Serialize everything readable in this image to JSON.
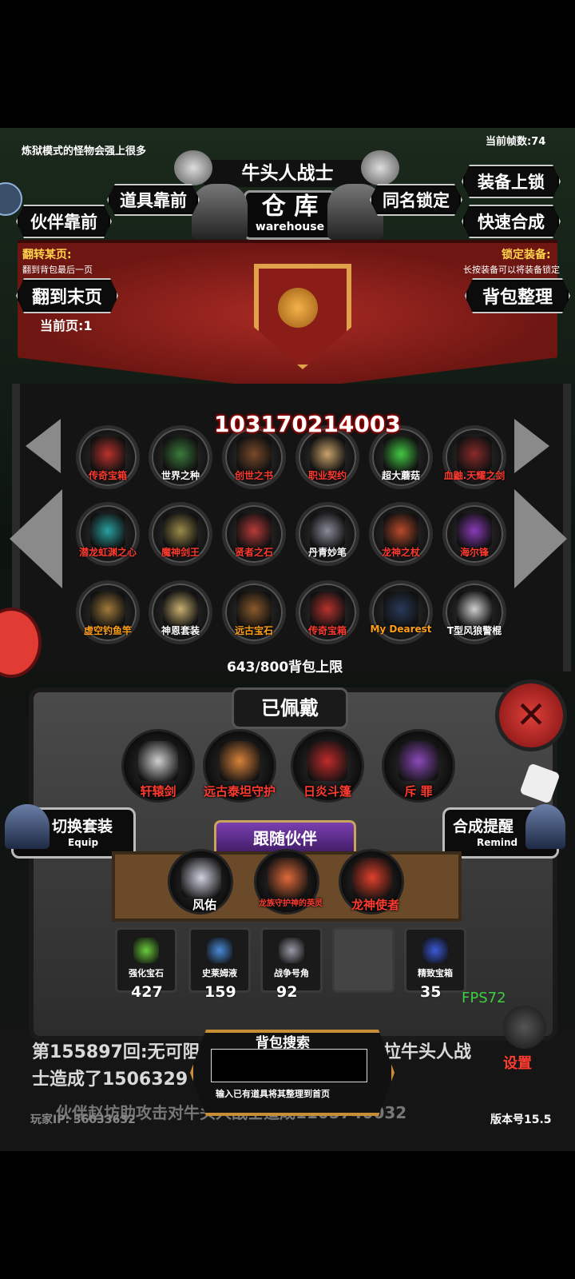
{
  "hud": {
    "hint_top": "炼狱模式的怪物会强上很多",
    "fps_label": "当前帧数:74",
    "boss_name": "牛头人战士",
    "title_cn": "仓 库",
    "title_en": "warehouse"
  },
  "buttons": {
    "equip_lock": "装备上锁",
    "items_front": "道具靠前",
    "same_name_lock": "同名锁定",
    "partner_front": "伙伴靠前",
    "quick_merge": "快速合成",
    "goto_last": "翻到末页",
    "bag_sort": "背包整理",
    "switch_set": "切换套装",
    "switch_set_en": "Equip",
    "merge_remind": "合成提醒",
    "merge_remind_en": "Remind",
    "settings": "设置"
  },
  "info": {
    "flip_title": "翻转某页:",
    "flip_desc": "翻到背包最后一页",
    "lock_title": "锁定装备:",
    "lock_desc": "长按装备可以将装备锁定",
    "current_page": "当前页:1",
    "damage_number": "103170214003",
    "bag_capacity": "643/800背包上限"
  },
  "inventory": [
    {
      "label": "传奇宝箱",
      "color": "#ff3b2f",
      "icon": "chest-icon"
    },
    {
      "label": "世界之种",
      "color": "#ffffff",
      "icon": "seed-icon"
    },
    {
      "label": "创世之书",
      "color": "#ff3b2f",
      "icon": "book-icon"
    },
    {
      "label": "职业契约",
      "color": "#ff3b2f",
      "icon": "scroll-icon"
    },
    {
      "label": "超大蘑菇",
      "color": "#ffffff",
      "icon": "mushroom-icon"
    },
    {
      "label": "血鼬.天耀之剑",
      "color": "#ff3b2f",
      "icon": "sword-icon"
    },
    {
      "label": "潜龙虹渊之心",
      "color": "#ff3b2f",
      "icon": "heart-crystal-icon"
    },
    {
      "label": "魔神剑王",
      "color": "#ff3b2f",
      "icon": "armor-icon"
    },
    {
      "label": "贤者之石",
      "color": "#ff3b2f",
      "icon": "stone-icon"
    },
    {
      "label": "丹青妙笔",
      "color": "#ffffff",
      "icon": "brush-icon"
    },
    {
      "label": "龙神之杖",
      "color": "#ff3b2f",
      "icon": "staff-icon"
    },
    {
      "label": "海尔锋",
      "color": "#ff3b2f",
      "icon": "blade-icon"
    },
    {
      "label": "虚空钓鱼竿",
      "color": "#ff9f1a",
      "icon": "fishing-rod-icon"
    },
    {
      "label": "神恩套装",
      "color": "#ffffff",
      "icon": "set-icon"
    },
    {
      "label": "远古宝石",
      "color": "#ff9f1a",
      "icon": "gem-icon"
    },
    {
      "label": "传奇宝箱",
      "color": "#ff3b2f",
      "icon": "chest-icon"
    },
    {
      "label": "My Dearest",
      "color": "#ff9f1a",
      "icon": "orb-icon"
    },
    {
      "label": "T型风狼警棍",
      "color": "#ffffff",
      "icon": "baton-icon"
    }
  ],
  "equipped": {
    "title": "已佩戴",
    "items": [
      {
        "label": "轩辕剑",
        "icon": "sword-icon"
      },
      {
        "label": "远古泰坦守护",
        "icon": "titan-armor-icon"
      },
      {
        "label": "日炎斗篷",
        "icon": "cloak-icon"
      },
      {
        "label": "斥 罪",
        "icon": "scythe-icon"
      }
    ]
  },
  "partners": {
    "title": "跟随伙伴",
    "items": [
      {
        "label": "风佑",
        "icon": "dragon-icon"
      },
      {
        "label": "龙族守护神的英灵",
        "icon": "beast-icon"
      },
      {
        "label": "龙神使者",
        "icon": "fire-spirit-icon"
      }
    ]
  },
  "materials": [
    {
      "label": "强化宝石",
      "count": "427",
      "icon": "green-gem-icon"
    },
    {
      "label": "史莱姆液",
      "count": "159",
      "icon": "potion-icon"
    },
    {
      "label": "战争号角",
      "count": "92",
      "icon": "horn-icon"
    },
    {
      "label": "",
      "count": "",
      "icon": "empty-slot-icon"
    },
    {
      "label": "精致宝箱",
      "count": "35",
      "icon": "blue-chest-icon"
    }
  ],
  "chat": {
    "line1": "第155897回:无可阻",
    "line1_right": "拉牛头人战",
    "line2": "士造成了1506329",
    "line3": "伙伴赵坊助攻击对牛头人战士造成1105740032"
  },
  "search": {
    "label": "背包搜索",
    "hint": "输入已有道具将其整理到首页",
    "value": ""
  },
  "footer": {
    "player_ip": "玩家IP: 36033632",
    "version": "版本号15.5",
    "fps": "FPS72"
  },
  "colors": {
    "accent_red": "#ff3b2f",
    "banner": "#a92a24",
    "gold": "#e0a24a"
  }
}
